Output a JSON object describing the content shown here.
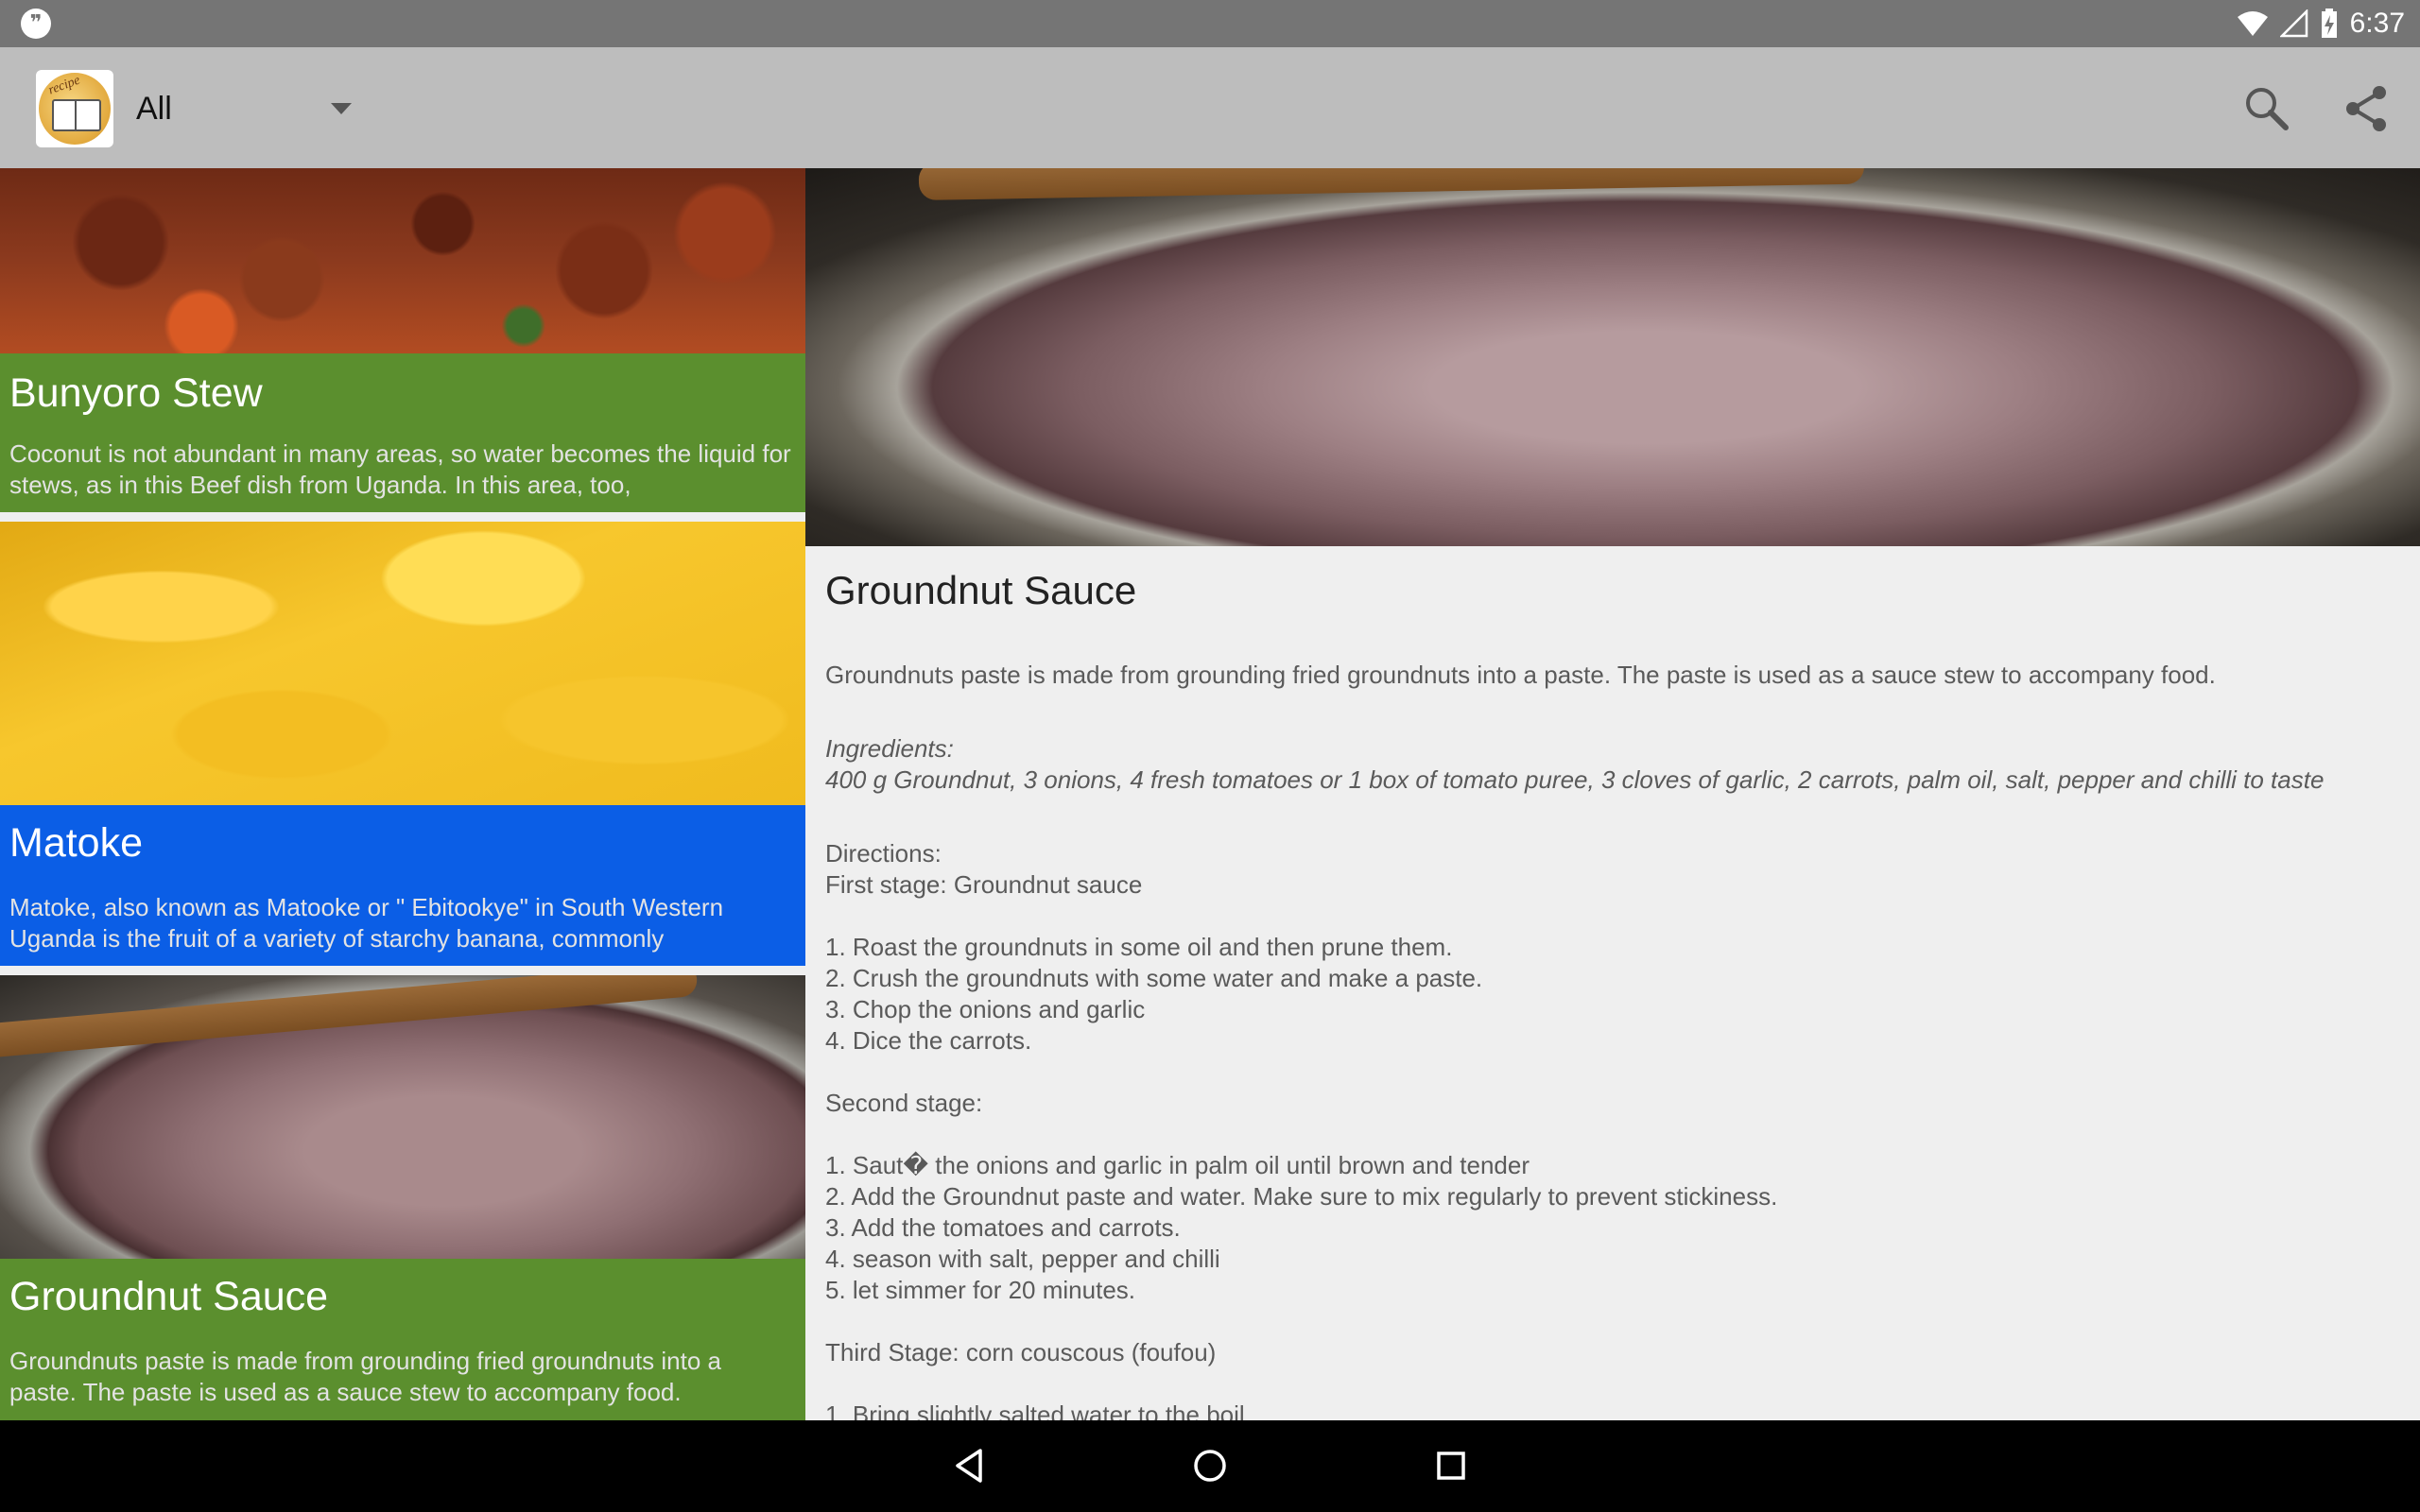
{
  "status_bar": {
    "time": "6:37",
    "icons": [
      "hangouts-icon",
      "wifi-icon",
      "signal-icon",
      "battery-charging-icon"
    ]
  },
  "app_bar": {
    "filter_value": "All",
    "actions": [
      "search-icon",
      "share-icon"
    ]
  },
  "recipes": [
    {
      "title": "Bunyoro Stew",
      "summary": "Coconut is not abundant in many areas, so water becomes the liquid for stews, as in this Beef dish from Uganda. In this area, too,",
      "panel_color": "#5b8f2e"
    },
    {
      "title": "Matoke",
      "summary": "Matoke, also known as Matooke or \" Ebitookye\" in South Western Uganda is the fruit of a variety of starchy banana, commonly",
      "panel_color": "#0b5ee6"
    },
    {
      "title": "Groundnut Sauce",
      "summary": "Groundnuts paste is made from grounding fried groundnuts into a paste. The paste is used as a sauce stew to accompany food.",
      "panel_color": "#5b8f2e"
    }
  ],
  "detail": {
    "title": "Groundnut Sauce",
    "intro": "Groundnuts paste is made from grounding fried groundnuts into a paste. The paste is used as a sauce stew to accompany food.",
    "ingredients_label": "Ingredients:",
    "ingredients": "400 g Groundnut, 3 onions, 4 fresh tomatoes or 1 box of tomato puree, 3 cloves of garlic, 2 carrots, palm oil, salt, pepper and chilli to taste",
    "directions_label": "Directions:",
    "stage1_label": "First stage: Groundnut sauce",
    "stage1_steps": [
      "1. Roast the groundnuts in some oil and then prune them.",
      "2. Crush the groundnuts with some water and make a paste.",
      "3. Chop the onions and garlic",
      "4. Dice the carrots."
    ],
    "stage2_label": "Second stage:",
    "stage2_steps": [
      "1. Saut� the onions and garlic in palm oil until brown and tender",
      "2. Add the Groundnut paste and water. Make sure to mix regularly to prevent stickiness.",
      "3. Add the tomatoes and carrots.",
      "4. season with salt, pepper and chilli",
      "5. let simmer for 20 minutes."
    ],
    "stage3_label": "Third Stage: corn couscous (foufou)",
    "stage3_steps": [
      "1. Bring slightly salted water to the boil"
    ]
  },
  "nav_bar": {
    "buttons": [
      "back-icon",
      "home-icon",
      "recents-icon"
    ]
  }
}
